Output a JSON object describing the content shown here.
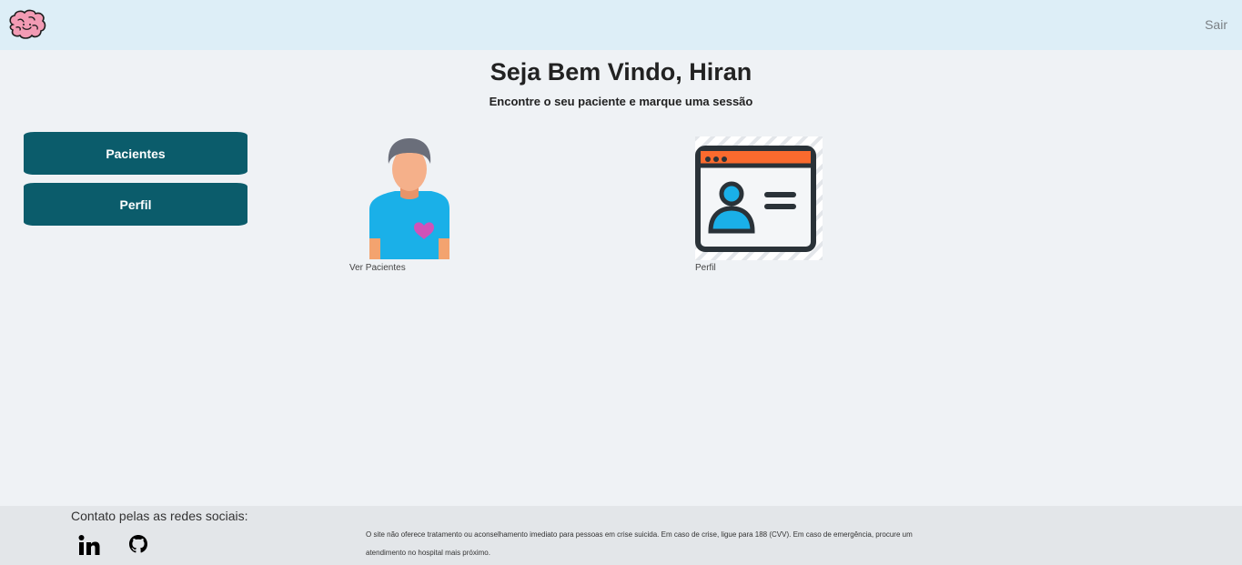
{
  "header": {
    "logo_icon": "brain-icon",
    "logout_label": "Sair"
  },
  "main": {
    "title": "Seja Bem Vindo, Hiran",
    "subtitle": "Encontre o seu paciente e marque uma sessão"
  },
  "sidebar": {
    "items": [
      {
        "label": "Pacientes"
      },
      {
        "label": "Perfil"
      }
    ]
  },
  "cards": [
    {
      "icon": "patient-person-icon",
      "label": "Ver Pacientes"
    },
    {
      "icon": "profile-id-card-icon",
      "label": "Perfil"
    }
  ],
  "footer": {
    "contact_title": "Contato pelas as redes sociais:",
    "social": [
      {
        "icon": "linkedin-icon"
      },
      {
        "icon": "github-icon"
      }
    ],
    "disclaimer": "O site não oferece tratamento ou aconselhamento imediato para pessoas em crise suicida. Em caso de crise, ligue para 188 (CVV). Em caso de emergência, procure um atendimento no hospital mais próximo."
  },
  "colors": {
    "navbar_bg": "#ddeef7",
    "page_bg": "#eff2f5",
    "button_bg": "#0b5c6b",
    "footer_bg": "#e3e6e9"
  }
}
